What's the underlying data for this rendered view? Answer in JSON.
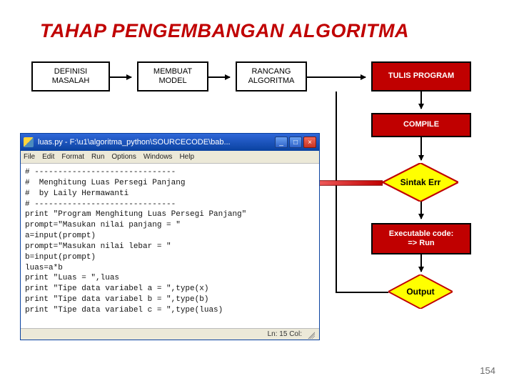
{
  "title": "TAHAP PENGEMBANGAN ALGORITMA",
  "steps": {
    "definisi": "DEFINISI\nMASALAH",
    "membuat": "MEMBUAT\nMODEL",
    "rancang": "RANCANG\nALGORITMA",
    "tulis": "TULIS PROGRAM",
    "compile": "COMPILE",
    "sintak": "Sintak Err",
    "exec": "Executable code:\n=> Run",
    "output": "Output"
  },
  "editor": {
    "title": "luas.py - F:\\u1\\algoritma_python\\SOURCECODE\\bab...",
    "menus": [
      "File",
      "Edit",
      "Format",
      "Run",
      "Options",
      "Windows",
      "Help"
    ],
    "code_lines": [
      "# ------------------------------",
      "#  Menghitung Luas Persegi Panjang",
      "#  by Laily Hermawanti",
      "# ------------------------------",
      "print \"Program Menghitung Luas Persegi Panjang\"",
      "prompt=\"Masukan nilai panjang = \"",
      "a=input(prompt)",
      "prompt=\"Masukan nilai lebar = \"",
      "b=input(prompt)",
      "luas=a*b",
      "print \"Luas = \",luas",
      "print \"Tipe data variabel a = \",type(x)",
      "print \"Tipe data variabel b = \",type(b)",
      "print \"Tipe data variabel c = \",type(luas)"
    ],
    "status": "Ln: 15 Col:"
  },
  "page_number": "154"
}
